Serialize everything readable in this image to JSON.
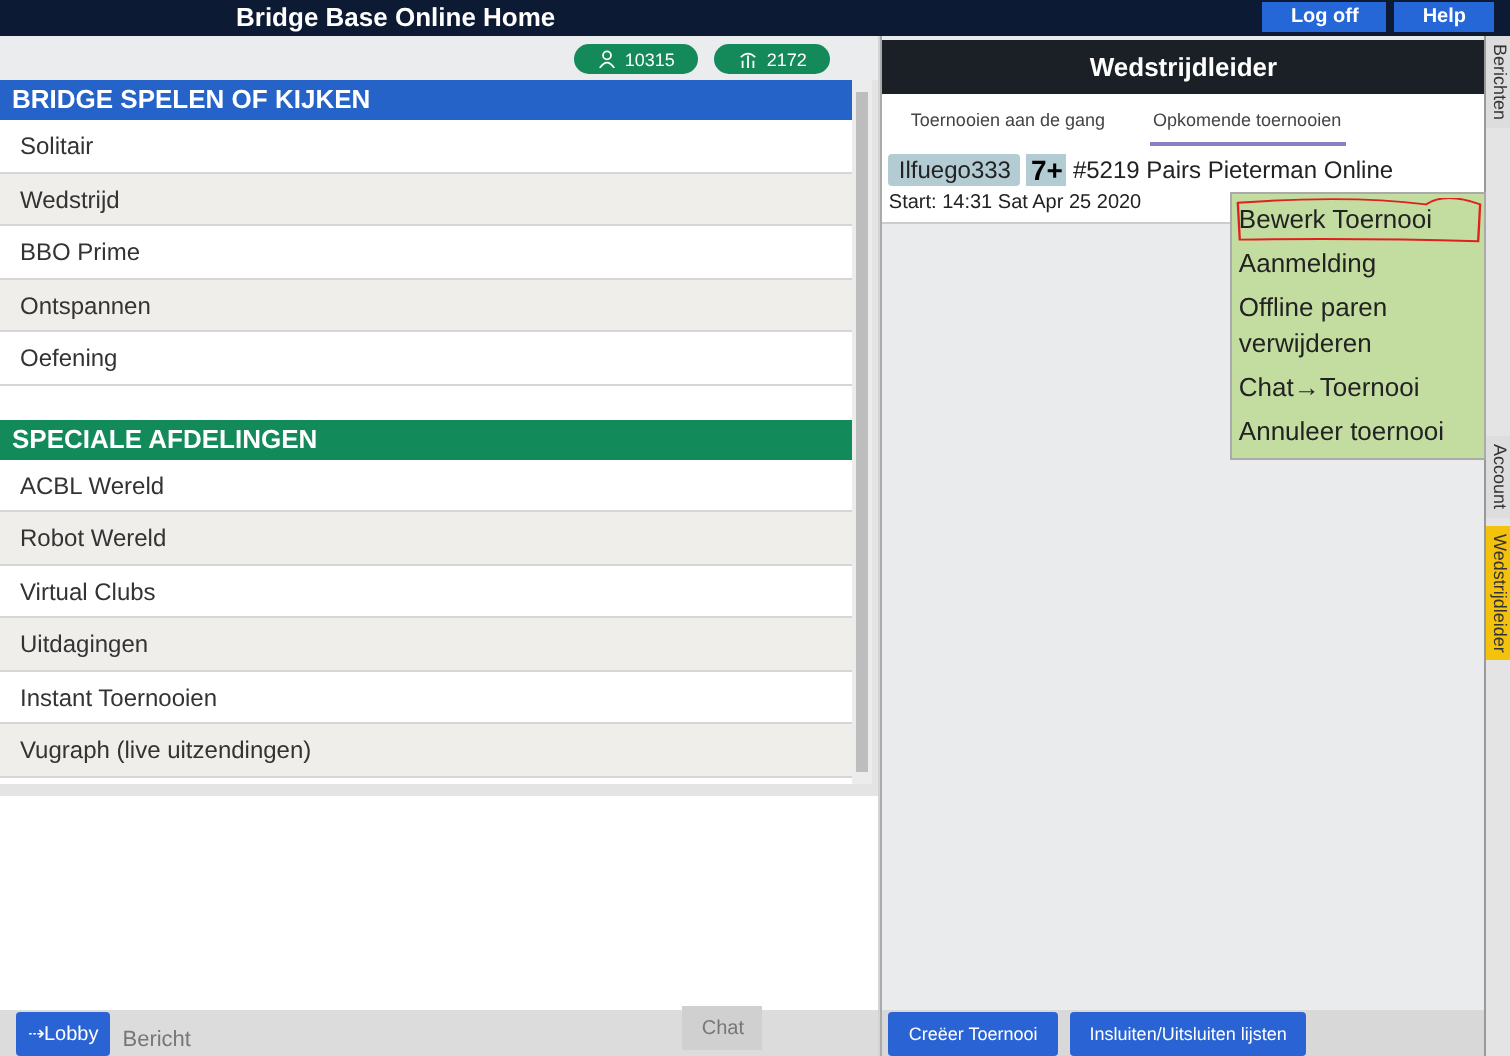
{
  "top_bar": {
    "title": "Bridge Base Online Home",
    "buttons": [
      {
        "label": "Log off"
      },
      {
        "label": "Help"
      }
    ]
  },
  "counters": [
    {
      "kind": "people",
      "value": "10315"
    },
    {
      "kind": "tables",
      "value": "2172"
    }
  ],
  "sections": [
    {
      "title": "BRIDGE SPELEN OF KIJKEN",
      "color": "#2563c9",
      "items": [
        "Solitair",
        "Wedstrijd",
        "BBO Prime",
        "Ontspannen",
        "Oefening"
      ]
    },
    {
      "title": "SPECIALE AFDELINGEN",
      "color": "#138a5a",
      "items": [
        "ACBL Wereld",
        "Robot Wereld",
        "Virtual Clubs",
        "Uitdagingen",
        "Instant Toernooien",
        "Vugraph (live uitzendingen)"
      ]
    }
  ],
  "chat_bar": {
    "lobby_button": "⇢Lobby",
    "message_placeholder": "Bericht",
    "chat_button": {
      "label": "Chat",
      "disabled": true
    }
  },
  "director": {
    "title": "Wedstrijdleider",
    "tabs": [
      {
        "label": "Toernooien aan de gang",
        "selected": false
      },
      {
        "label": "Opkomende toernooien",
        "selected": true
      }
    ],
    "tournament": {
      "host": "Ilfuego333",
      "badge": "7+",
      "name": "#5219 Pairs Pieterman Online",
      "start": "Start: 14:31 Sat Apr 25 2020"
    },
    "menu": [
      {
        "label": "Bewerk Toernooi",
        "circled": true
      },
      {
        "label": "Aanmelding",
        "circled": false
      },
      {
        "label": "Offline paren verwijderen",
        "circled": false
      },
      {
        "label": "Chat→Toernooi",
        "circled": false
      },
      {
        "label": "Annuleer toernooi",
        "circled": false
      }
    ],
    "buttons": [
      "Creëer Toernooi",
      "Insluiten/Uitsluiten lijsten"
    ]
  },
  "side_tabs": [
    {
      "label": "Berichten",
      "selected": false
    },
    {
      "label": "Account",
      "selected": false
    },
    {
      "label": "Wedstrijdleider",
      "selected": true
    }
  ]
}
